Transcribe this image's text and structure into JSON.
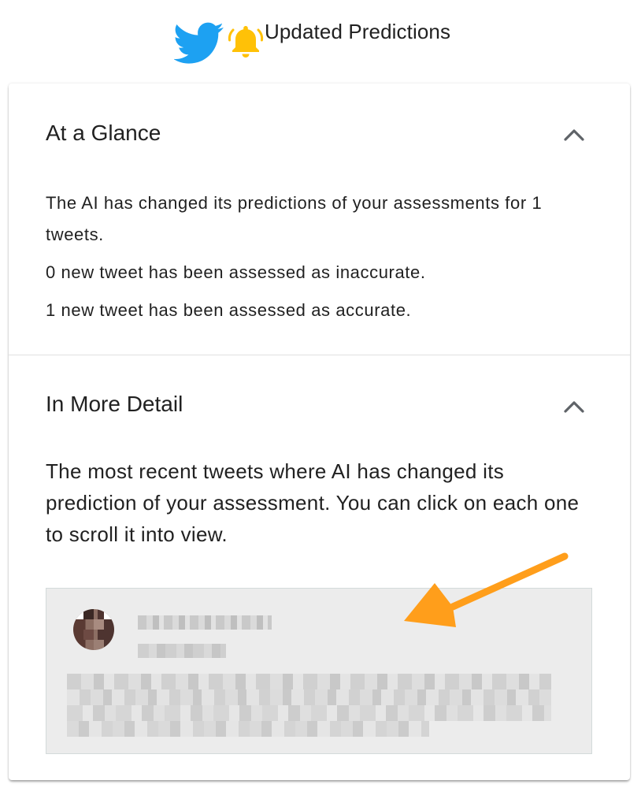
{
  "header": {
    "title": "Updated Predictions",
    "icons": [
      "twitter-icon",
      "bell-icon"
    ],
    "colors": {
      "twitter": "#1da1f2",
      "bell": "#ffc107"
    }
  },
  "glance": {
    "title": "At a Glance",
    "lines": [
      "The AI has changed its predictions of your assessments for 1 tweets.",
      "0 new tweet has been assessed as inaccurate.",
      "1 new tweet has been assessed as accurate."
    ]
  },
  "detail": {
    "title": "In More Detail",
    "description": "The most recent tweets where AI has changed its prediction of your assessment. You can click on each one to scroll it into view."
  },
  "annotation": {
    "arrow_color": "#ff9e1b"
  }
}
